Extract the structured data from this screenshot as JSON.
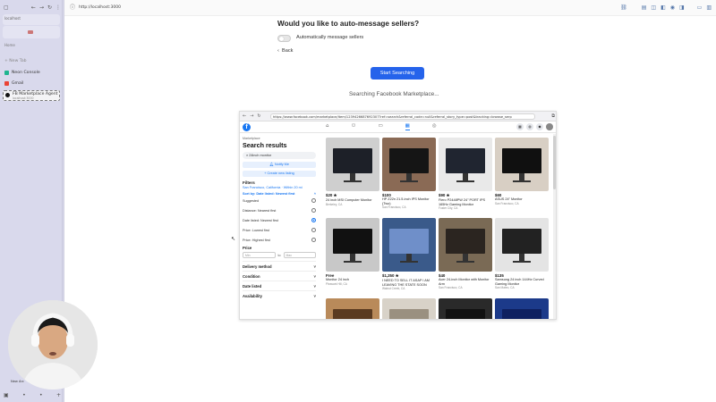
{
  "sidebar": {
    "box1_label": "localhost",
    "box2_label": "",
    "section_label": "Home",
    "new_tab": "+ New Tab",
    "items": [
      {
        "label": "Neon Console",
        "color": "#1fb58f"
      },
      {
        "label": "Gmail",
        "color": "#ea4335"
      }
    ],
    "active_item": {
      "label": "FB Marketplace Agent",
      "sub": "localhost:3000"
    },
    "newtab_bottom": "New Arc"
  },
  "browser": {
    "url": "http://localhost:3000"
  },
  "page": {
    "question": "Would you like to auto-message sellers?",
    "toggle_label": "Automatically message sellers",
    "back_label": "Back",
    "start_button": "Start Searching",
    "status": "Searching Facebook Marketplace..."
  },
  "embedded": {
    "url": "https://www.facebook.com/marketplace/item/1239426687692307?ref=search&referral_code=null&referral_story_type=post&tracking=browse_serp",
    "sidebar": {
      "breadcrumb": "Marketplace",
      "heading": "Search results",
      "search_value": "24inch monitor",
      "notify_button": "Notify Me",
      "create_button": "+ Create new listing",
      "filters_label": "Filters",
      "location": "San Francisco, California · Within 20 mi",
      "sort_label": "Sort by: Date listed: Newest first",
      "sort_options": [
        {
          "label": "Suggested",
          "selected": false
        },
        {
          "label": "Distance: Nearest first",
          "selected": false
        },
        {
          "label": "Date listed: Newest first",
          "selected": true
        },
        {
          "label": "Price: Lowest first",
          "selected": false
        },
        {
          "label": "Price: Highest first",
          "selected": false
        }
      ],
      "price_label": "Price",
      "min_placeholder": "Min",
      "to_label": "to",
      "max_placeholder": "Max",
      "sections": [
        "Delivery method",
        "Condition",
        "Date listed",
        "Availability"
      ]
    },
    "listings": [
      {
        "price": "$20 ★",
        "title": "24 inch MSI Computer Monitor",
        "loc": "Berkeley, CA",
        "bg": "#cfcfcf",
        "screen": "#1d2028"
      },
      {
        "price": "$100",
        "title": "HP Z22n 21.5-inch IPS Monitor (Two)",
        "loc": "San Francisco, CA",
        "bg": "#8a6a55",
        "screen": "#151515"
      },
      {
        "price": "$90 ★",
        "title": "Fiero P2448PW 24\" PORT IPS 165Hz Gaming Monitor",
        "loc": "Foster City, CA",
        "bg": "#e9e9e9",
        "screen": "#202530"
      },
      {
        "price": "$60",
        "title": "ASUS 24\" Monitor",
        "loc": "San Francisco, CA",
        "bg": "#d8cfc4",
        "screen": "#101010"
      },
      {
        "price": "Free",
        "title": "Monitor 24 inch",
        "loc": "Pleasant Hill, CA",
        "bg": "#c8c8c8",
        "screen": "#111111"
      },
      {
        "price": "$1,250 ★",
        "title": "I NEED TO SELL IT ASAP I AM LEAVING THE STATE SOON",
        "loc": "Walnut Creek, CA",
        "bg": "#3a5a8a",
        "screen": "#6f8fc9"
      },
      {
        "price": "$40",
        "title": "Acer 24-inch Monitor with Monitor Arm",
        "loc": "San Francisco, CA",
        "bg": "#7a6a55",
        "screen": "#2b2520"
      },
      {
        "price": "$135",
        "title": "Samsung 24 inch 144Hz Curved Gaming Monitor",
        "loc": "San Mateo, CA",
        "bg": "#e4e4e4",
        "screen": "#222222"
      },
      {
        "price": "",
        "title": "",
        "loc": "",
        "bg": "#b98a5a",
        "screen": "#5a3a20"
      },
      {
        "price": "",
        "title": "",
        "loc": "",
        "bg": "#d8d2c8",
        "screen": "#9a9080"
      },
      {
        "price": "",
        "title": "",
        "loc": "",
        "bg": "#2a2a2a",
        "screen": "#111111"
      },
      {
        "price": "",
        "title": "",
        "loc": "",
        "bg": "#1c3a8a",
        "screen": "#0e2060"
      }
    ]
  },
  "colors": {
    "accent": "#2563eb",
    "facebook": "#1877f2"
  }
}
